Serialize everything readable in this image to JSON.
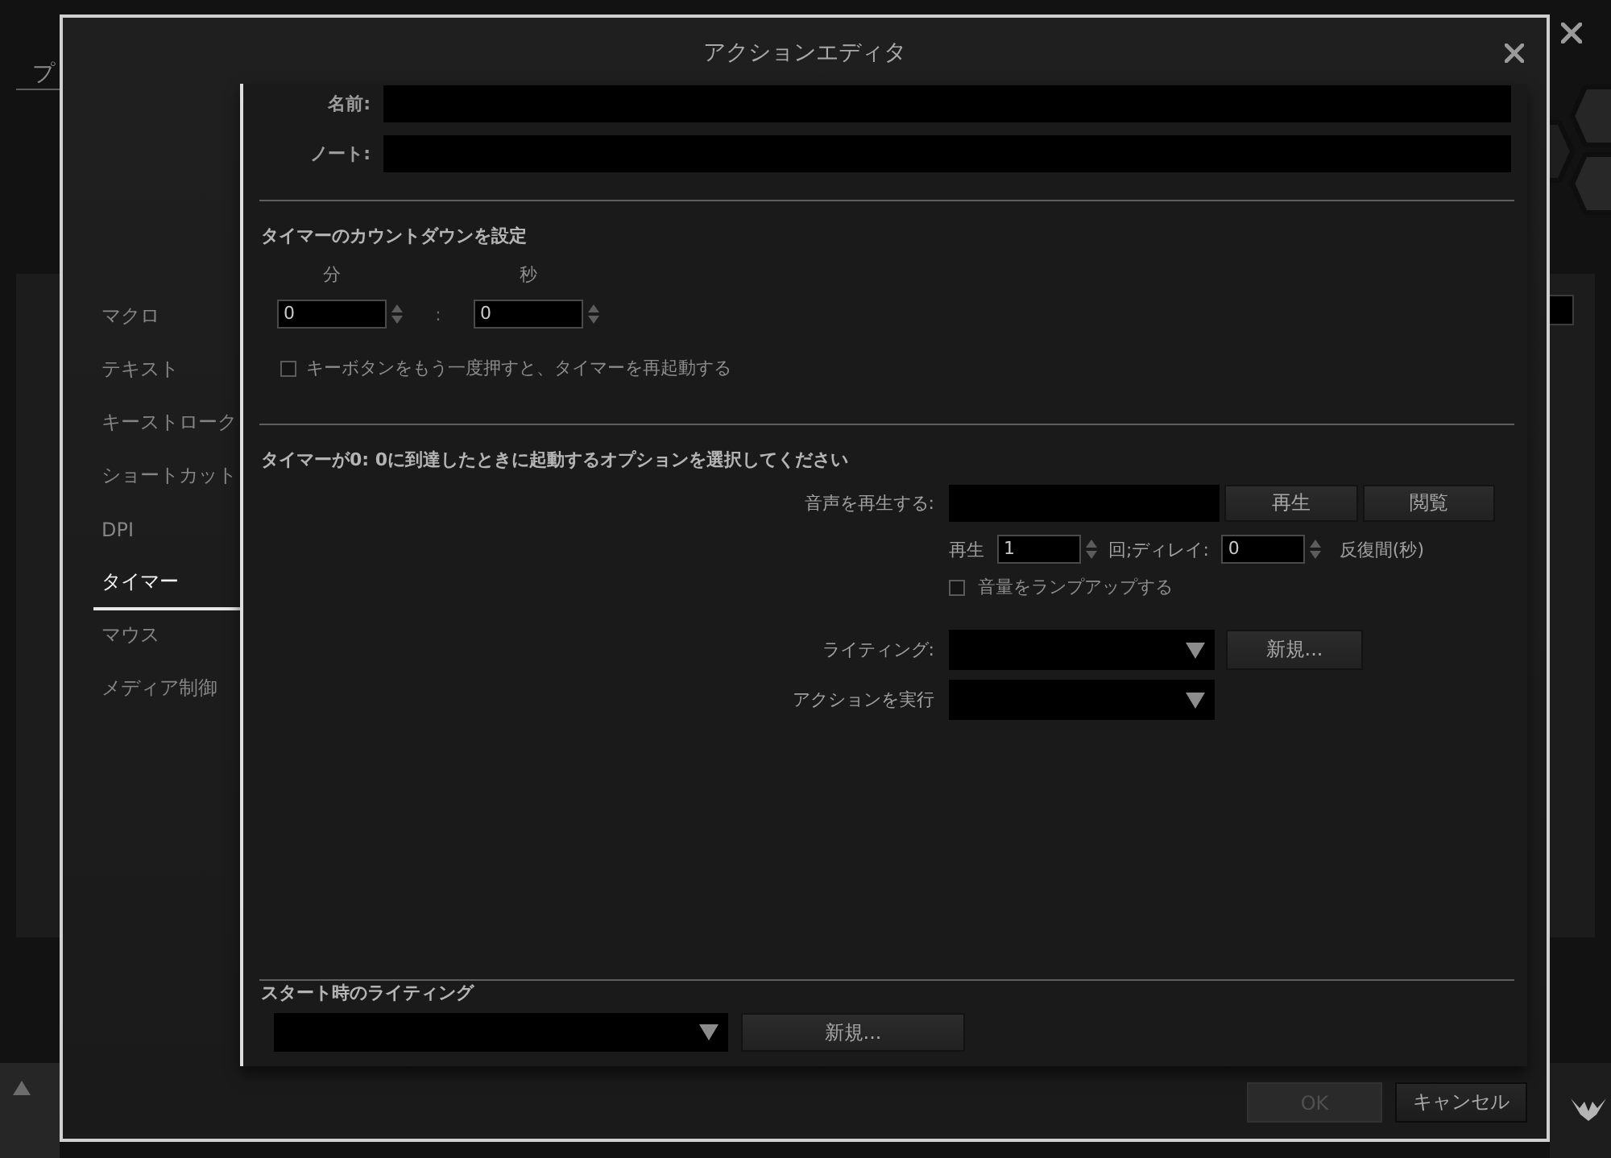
{
  "background": {
    "tab": "プ"
  },
  "dialog": {
    "title": "アクションエディタ",
    "nav": [
      {
        "label": "マクロ",
        "selected": false
      },
      {
        "label": "テキスト",
        "selected": false
      },
      {
        "label": "キーストローク",
        "selected": false
      },
      {
        "label": "ショートカット",
        "selected": false
      },
      {
        "label": "DPI",
        "selected": false
      },
      {
        "label": "タイマー",
        "selected": true
      },
      {
        "label": "マウス",
        "selected": false
      },
      {
        "label": "メディア制御",
        "selected": false
      }
    ],
    "fields": [
      {
        "label": "名前:"
      },
      {
        "label": "ノート:"
      }
    ],
    "countdown": {
      "heading": "タイマーのカウントダウンを設定",
      "spinners": [
        {
          "label": "分",
          "value": "0"
        },
        {
          "label": "秒",
          "value": "0"
        }
      ],
      "separator": ":",
      "restart": {
        "label": "キーボタンをもう一度押すと、タイマーを再起動する",
        "checked": false
      }
    },
    "on_zero": {
      "heading": "タイマーが0: 0に到達したときに起動するオプションを選択してください",
      "sound": {
        "label": "音声を再生する:",
        "buttons": [
          "再生",
          "閲覧"
        ]
      },
      "repeat": {
        "label": "再生",
        "count": "1",
        "delay_label": "回;ディレイ:",
        "delay": "0",
        "unit": "反復間(秒)"
      },
      "ramp_up": {
        "label": "音量をランプアップする",
        "checked": false
      },
      "dropdowns": [
        {
          "label": "ライティング:",
          "button": "新規..."
        },
        {
          "label": "アクションを実行"
        }
      ]
    },
    "start_lighting": {
      "heading": "スタート時のライティング",
      "button": "新規..."
    },
    "buttons": [
      {
        "label": "OK",
        "disabled": true
      },
      {
        "label": "キャンセル",
        "disabled": false
      }
    ]
  }
}
